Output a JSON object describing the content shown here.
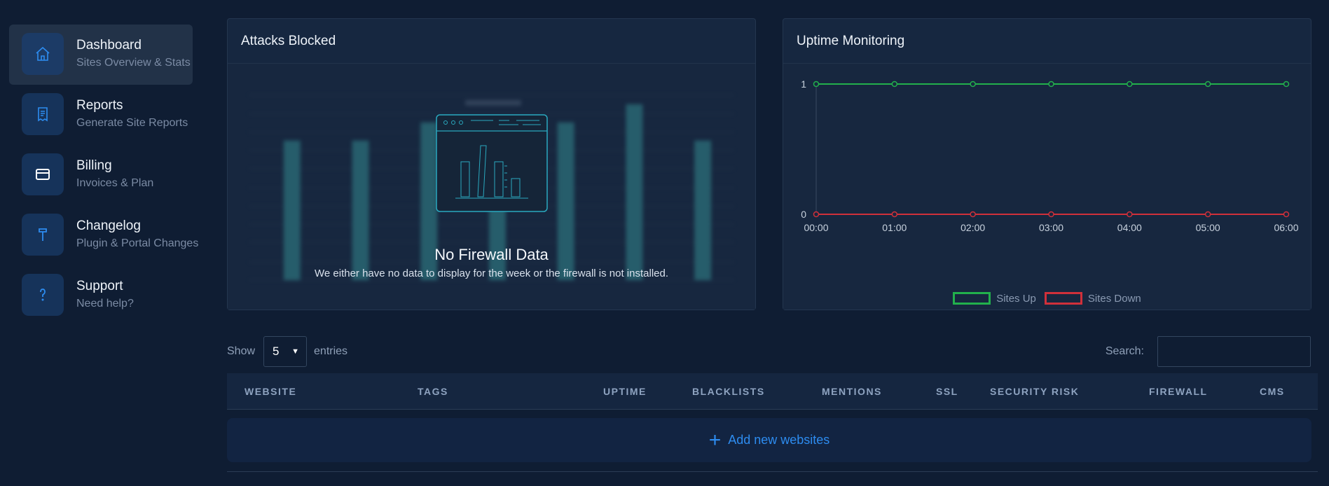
{
  "sidebar": {
    "items": [
      {
        "title": "Dashboard",
        "subtitle": "Sites Overview & Stats",
        "icon": "home-icon",
        "active": true
      },
      {
        "title": "Reports",
        "subtitle": "Generate Site Reports",
        "icon": "receipt-icon"
      },
      {
        "title": "Billing",
        "subtitle": "Invoices & Plan",
        "icon": "credit-card-icon"
      },
      {
        "title": "Changelog",
        "subtitle": "Plugin & Portal Changes",
        "icon": "hammer-icon"
      },
      {
        "title": "Support",
        "subtitle": "Need help?",
        "icon": "question-icon"
      }
    ]
  },
  "attacks": {
    "title": "Attacks Blocked",
    "empty_title": "No Firewall Data",
    "empty_message": "We either have no data to display for the week or the firewall is not installed."
  },
  "uptime": {
    "title": "Uptime Monitoring",
    "legend_up": "Sites Up",
    "legend_down": "Sites Down"
  },
  "chart_data": {
    "type": "line",
    "x": [
      "00:00",
      "01:00",
      "02:00",
      "03:00",
      "04:00",
      "05:00",
      "06:00"
    ],
    "series": [
      {
        "name": "Sites Up",
        "values": [
          1,
          1,
          1,
          1,
          1,
          1,
          1
        ],
        "color": "#22b04c"
      },
      {
        "name": "Sites Down",
        "values": [
          0,
          0,
          0,
          0,
          0,
          0,
          0
        ],
        "color": "#d0303a"
      }
    ],
    "yticks": [
      "1",
      "0"
    ],
    "ylim": [
      0,
      1
    ],
    "legend": "bottom"
  },
  "table": {
    "show_label": "Show",
    "entries_value": "5",
    "entries_label": "entries",
    "search_label": "Search:",
    "columns": [
      "WEBSITE",
      "TAGS",
      "UPTIME",
      "BLACKLISTS",
      "MENTIONS",
      "SSL",
      "SECURITY RISK",
      "FIREWALL",
      "CMS"
    ],
    "add_label": "Add new websites"
  },
  "colors": {
    "accent": "#2d8cf0",
    "up": "#22b04c",
    "down": "#d0303a"
  }
}
